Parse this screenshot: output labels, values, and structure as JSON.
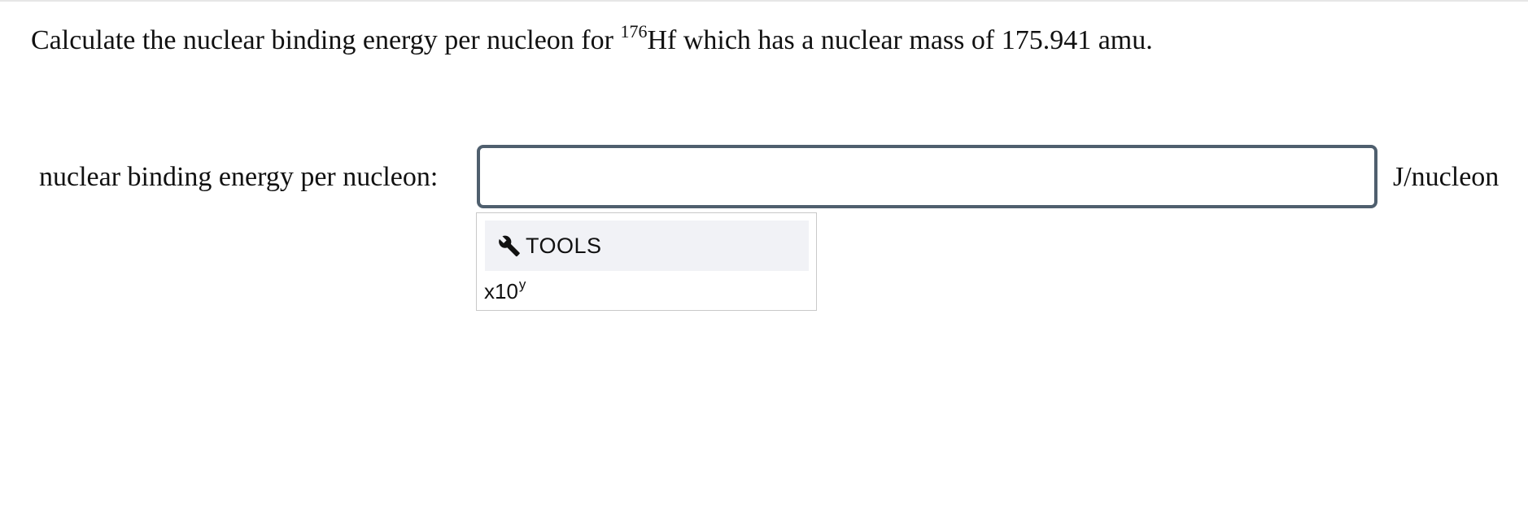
{
  "question": {
    "prefix": "Calculate the nuclear binding energy per nucleon for ",
    "isotope_mass_number": "176",
    "isotope_symbol": "Hf",
    "suffix": " which has a nuclear mass of 175.941 amu."
  },
  "answer": {
    "label": "nuclear binding energy per nucleon:",
    "value": "",
    "placeholder": "",
    "unit": "J/nucleon"
  },
  "tools": {
    "header_label": "TOOLS",
    "header_icon": "wrench-icon",
    "exponent_button": {
      "base": "x10",
      "exponent": "y"
    }
  },
  "colors": {
    "input_border": "#4f5f6e",
    "tools_header_bg": "#f1f2f6",
    "panel_border": "#c9c9c9"
  }
}
